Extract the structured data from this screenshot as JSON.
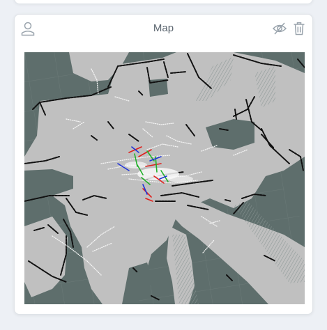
{
  "panel": {
    "title": "Map"
  },
  "icons": {
    "user": "user-icon",
    "hide": "eye-off-icon",
    "delete": "trash-icon"
  },
  "colors": {
    "background": "#edf0f5",
    "panel": "#ffffff",
    "title_text": "#5c6670",
    "icon": "#9aa4ad",
    "unknown_space": "#5e6e6c",
    "free_space": "#c0c0c0",
    "walls": "#101010",
    "scan_points": "#f4f4f4",
    "axis_x": "#e0201c",
    "axis_y": "#22b02a",
    "axis_z": "#2034d8"
  }
}
